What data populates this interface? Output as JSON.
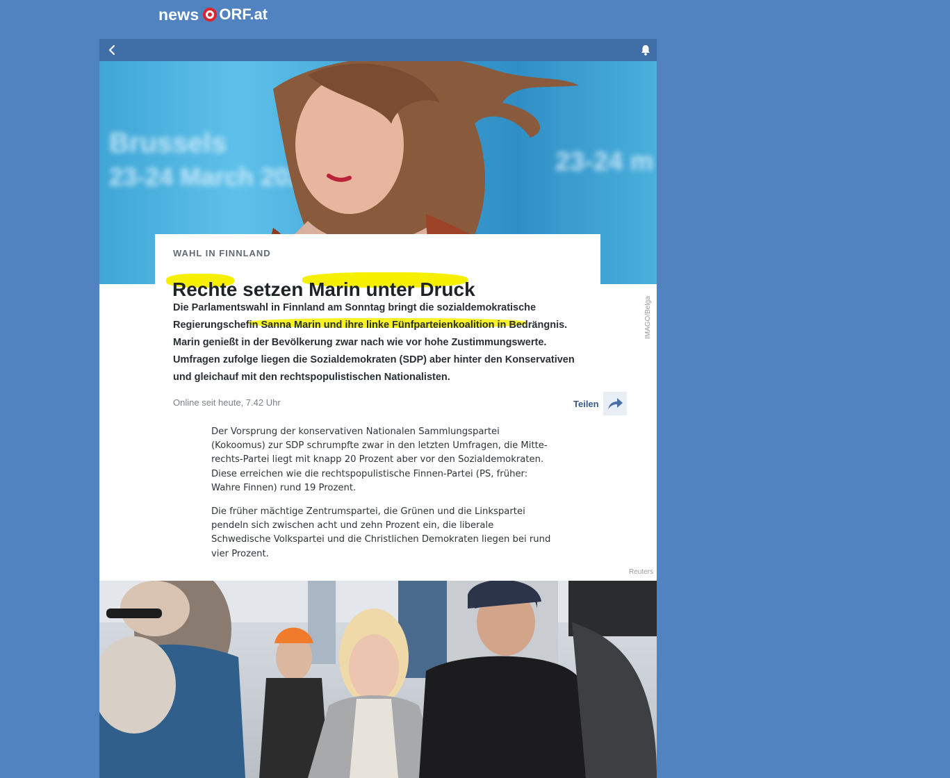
{
  "brand": {
    "news": "news",
    "orf": "ORF.at"
  },
  "toolbar": {
    "back_icon": "chevron-left-icon",
    "bell_icon": "bell-icon"
  },
  "hero": {
    "blur_text_1": "Brussels",
    "blur_text_2": "23-24 March 2023",
    "blur_text_3": "23-24 m",
    "credit": "IMAGO/Belga"
  },
  "article": {
    "kicker": "Wahl in Finnland",
    "title_parts": [
      "Rechte",
      " setzen ",
      "Marin unter Druck"
    ],
    "lead_parts": [
      "Die Parlamentswahl in Finnland am Sonntag bringt die sozialdemokratische Regierungschefin ",
      "Sanna Marin und ihre linke Fünfparteienkoalition in Bedräng",
      "nis. Marin genießt in der Bevölkerung zwar nach wie vor hohe Zustimmungswerte. Umfragen zufolge liegen die Sozialdemokraten (SDP) aber hinter den Konservativen und gleichauf mit den rechtspopulistischen Nationalisten."
    ],
    "timestamp": "Online seit heute, 7.42 Uhr",
    "share_label": "Teilen",
    "paragraphs": [
      "Der Vorsprung der konservativen Nationalen Sammlungspartei (Kokoomus) zur SDP schrumpfte zwar in den letzten Umfragen, die Mitte-rechts-Partei liegt mit knapp 20 Prozent aber vor den Sozialdemokraten. Diese erreichen wie die rechtspopulistische Finnen-Partei (PS, früher: Wahre Finnen) rund 19 Prozent.",
      "Die früher mächtige Zentrumspartei, die Grünen und die Linkspartei pendeln sich zwischen acht und zehn Prozent ein, die liberale Schwedische Volkspartei und die Christlichen Demokraten liegen bei rund vier Prozent."
    ]
  },
  "photo": {
    "credit": "Reuters"
  },
  "colors": {
    "page_bg": "#5183c0",
    "topbar": "#3f6da6",
    "highlight": "#f6f000",
    "orf_red": "#d9262e"
  }
}
